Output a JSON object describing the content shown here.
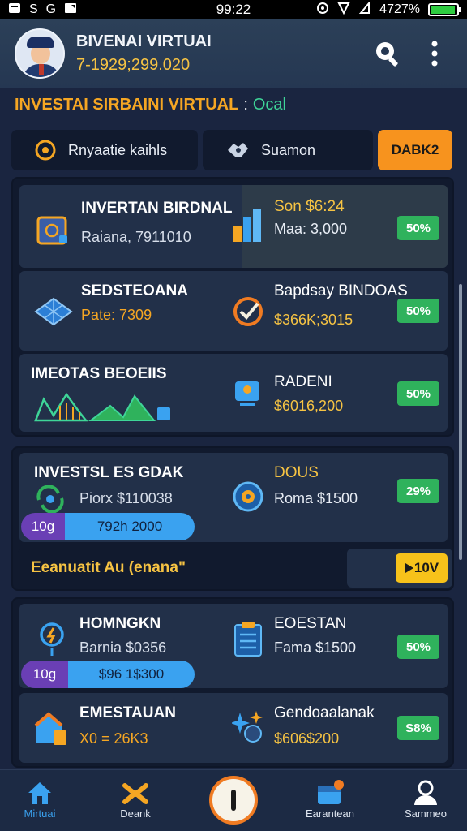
{
  "status": {
    "left_icons": [
      "S",
      "G"
    ],
    "time": "99:22",
    "battery": "4727%"
  },
  "header": {
    "name": "BIVENAI VIRTUAI",
    "balance": "7-1929;299.020"
  },
  "section": {
    "title": "INVESTAI SIRBAINI VIRTUAL",
    "separator": ":",
    "tag": "Ocal"
  },
  "tabs": [
    {
      "label": "Rnyaatie kaihls"
    },
    {
      "label": "Suamon"
    }
  ],
  "cta_tab": "DABK2",
  "group1": [
    {
      "title": "INVERTAN BIRDNAL",
      "sub": "Raiana, 7911010",
      "rtitle": "Son $6:24",
      "rsub": "Maa: 3,000",
      "badge": "50%"
    },
    {
      "title": "SEDSTEOANA",
      "sub": "Pate: 7309",
      "rtitle": "Bapdsay BINDOAS",
      "rsub": "$366K;3015",
      "badge": "50%"
    },
    {
      "title": "IMEOTAS BEOEIIS",
      "sub": "",
      "rtitle": "RADENI",
      "rsub": "$6016,200",
      "badge": "50%"
    }
  ],
  "group2": {
    "card": {
      "title": "INVESTSL ES GDAK",
      "sub": "Piorx $110038",
      "rtitle": "DOUS",
      "rsub": "Roma $1500",
      "badge": "29%",
      "progress_a": "10g",
      "progress_b": "792h 2000"
    },
    "notice": "Eeanuatit Au  (enana\"",
    "notice_btn": "10V"
  },
  "group3": [
    {
      "title": "HOMNGKN",
      "sub": "Barnia $0356",
      "rtitle": "EOESTAN",
      "rsub": "Fama $1500",
      "badge": "50%",
      "progress_a": "10g",
      "progress_b": "$96 1$300"
    },
    {
      "title": "EMESTAUAN",
      "sub": "X0 = 26K3",
      "rtitle": "Gendoaalanak",
      "rsub": "$606$200",
      "badge": "S8%"
    }
  ],
  "nav": [
    {
      "label": "Mirtuai"
    },
    {
      "label": "Deank"
    },
    {
      "label": "Earantean"
    },
    {
      "label": "Sammeo"
    }
  ],
  "colors": {
    "accent": "#f5a623",
    "green": "#2fb25c",
    "blue": "#3aa2f0",
    "bg": "#1a2540"
  }
}
